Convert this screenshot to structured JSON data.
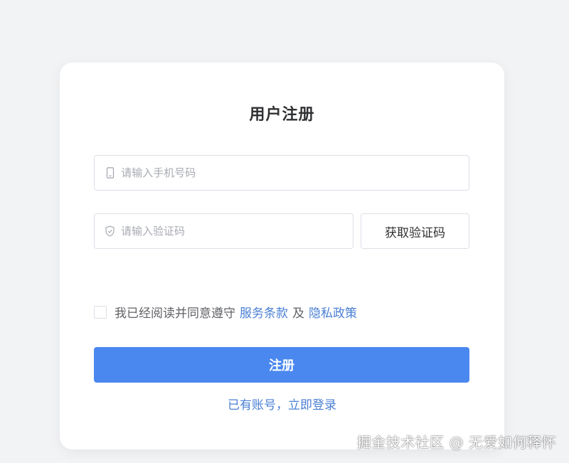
{
  "form": {
    "title": "用户注册",
    "phone_placeholder": "请输入手机号码",
    "phone_icon": "mobile-phone-icon",
    "code_placeholder": "请输入验证码",
    "code_icon": "shield-check-icon",
    "get_code_label": "获取验证码",
    "agreement_text": "我已经阅读并同意遵守",
    "terms_link": "服务条款",
    "and_text": "及",
    "privacy_link": "隐私政策",
    "agreement_checked": false,
    "submit_label": "注册",
    "login_link": "已有账号，立即登录"
  },
  "watermark": "掘金技术社区 @ 无爱如何释怀",
  "colors": {
    "background": "#f2f3f5",
    "card": "#ffffff",
    "primary": "#4a88f0",
    "link": "#4a7fd4",
    "border": "#dcdfe6",
    "placeholder": "#a8abb2"
  }
}
